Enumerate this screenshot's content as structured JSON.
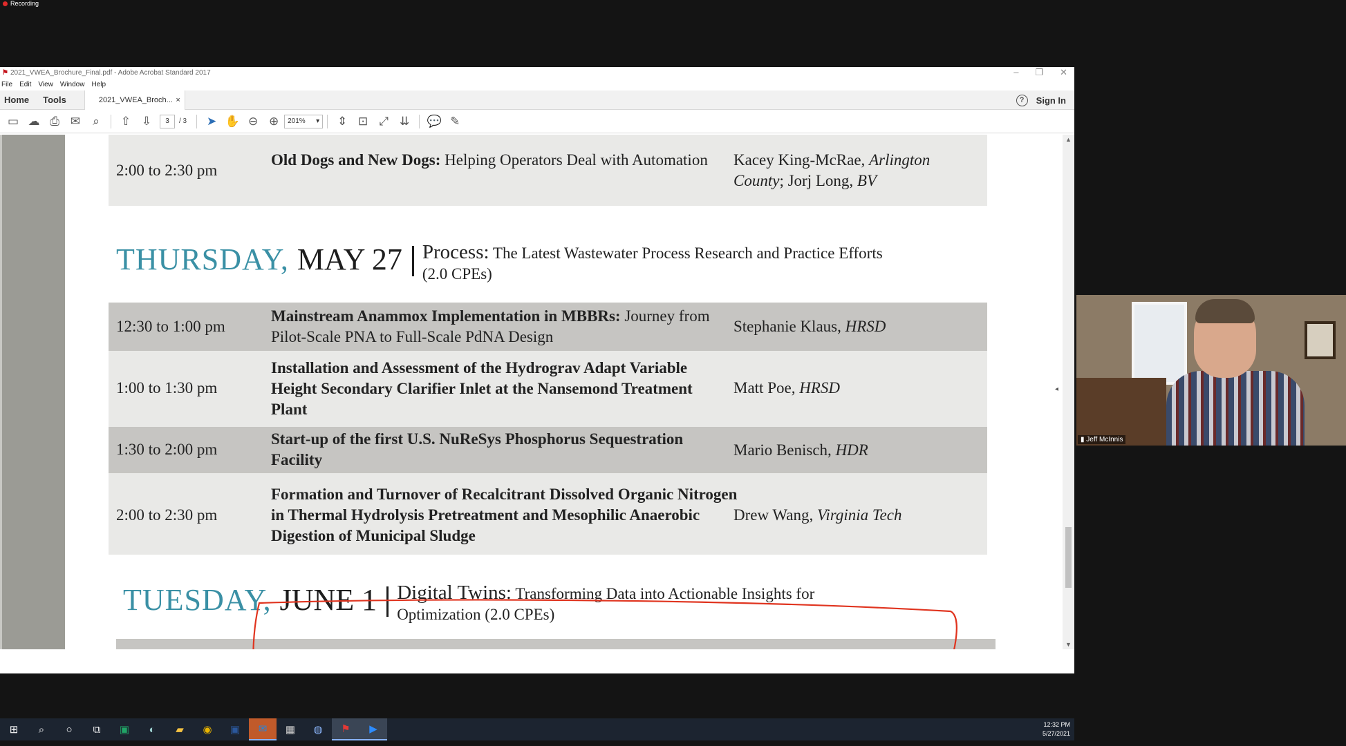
{
  "recording": {
    "label": "Recording"
  },
  "window": {
    "title": "2021_VWEA_Brochure_Final.pdf - Adobe Acrobat Standard 2017",
    "controls": [
      "–",
      "❐",
      "✕"
    ]
  },
  "menu": [
    "File",
    "Edit",
    "View",
    "Window",
    "Help"
  ],
  "tabs": {
    "home": "Home",
    "tools": "Tools",
    "doc": "2021_VWEA_Broch...",
    "close": "×",
    "signin": "Sign In"
  },
  "toolbar": {
    "page_current": "3",
    "page_total": "/ 3",
    "zoom": "201%"
  },
  "schedule": {
    "prev_row": {
      "time": "2:00 to 2:30 pm",
      "title_bold": "Old Dogs and New Dogs:",
      "title_rest": " Helping Operators Deal with Automation",
      "speaker": "Kacey King-McRae, ",
      "speaker_org": "Arlington County",
      "speaker_extra": "; Jorj Long, ",
      "speaker_extra_org": "BV"
    },
    "thursday": {
      "day": "THURSDAY,",
      "date": "MAY 27",
      "track_name": "Process:",
      "track_desc": " The Latest Wastewater Process Research and Practice Efforts",
      "cpe": "(2.0 CPEs)"
    },
    "rows": [
      {
        "time": "12:30 to 1:00 pm",
        "title_bold": "Mainstream Anammox Implementation in MBBRs:",
        "title_rest": " Journey from Pilot-Scale PNA to Full-Scale PdNA Design",
        "speaker": "Stephanie Klaus, ",
        "org": "HRSD"
      },
      {
        "time": "1:00 to 1:30 pm",
        "title_bold": "Installation and Assessment of the Hydrograv Adapt Variable Height Secondary Clarifier Inlet at the Nansemond Treatment Plant",
        "title_rest": "",
        "speaker": "Matt Poe, ",
        "org": "HRSD"
      },
      {
        "time": "1:30 to 2:00 pm",
        "title_bold": "Start-up of the first U.S. NuReSys Phosphorus Sequestration Facility",
        "title_rest": "",
        "speaker": "Mario Benisch, ",
        "org": "HDR"
      },
      {
        "time": "2:00 to 2:30 pm",
        "title_bold": "Formation and Turnover of Recalcitrant Dissolved Organic Nitrogen in Thermal Hydrolysis Pretreatment and Mesophilic Anaerobic Digestion of Municipal Sludge",
        "title_rest": "",
        "speaker": "Drew Wang, ",
        "org": "Virginia Tech"
      }
    ],
    "tuesday": {
      "day": "TUESDAY,",
      "date": "JUNE 1",
      "track_name": "Digital Twins:",
      "track_desc": " Transforming Data into Actionable Insights for",
      "cpe": "Optimization (2.0 CPEs)"
    }
  },
  "taskbar": {
    "time": "12:32 PM",
    "date": "5/27/2021"
  },
  "webcam": {
    "name": "Jeff McInnis"
  },
  "colors": {
    "day_teal": "#3a90a5",
    "annotation_red": "#e0341f",
    "row_dark": "#c6c5c2",
    "row_light": "#e9e9e7"
  }
}
